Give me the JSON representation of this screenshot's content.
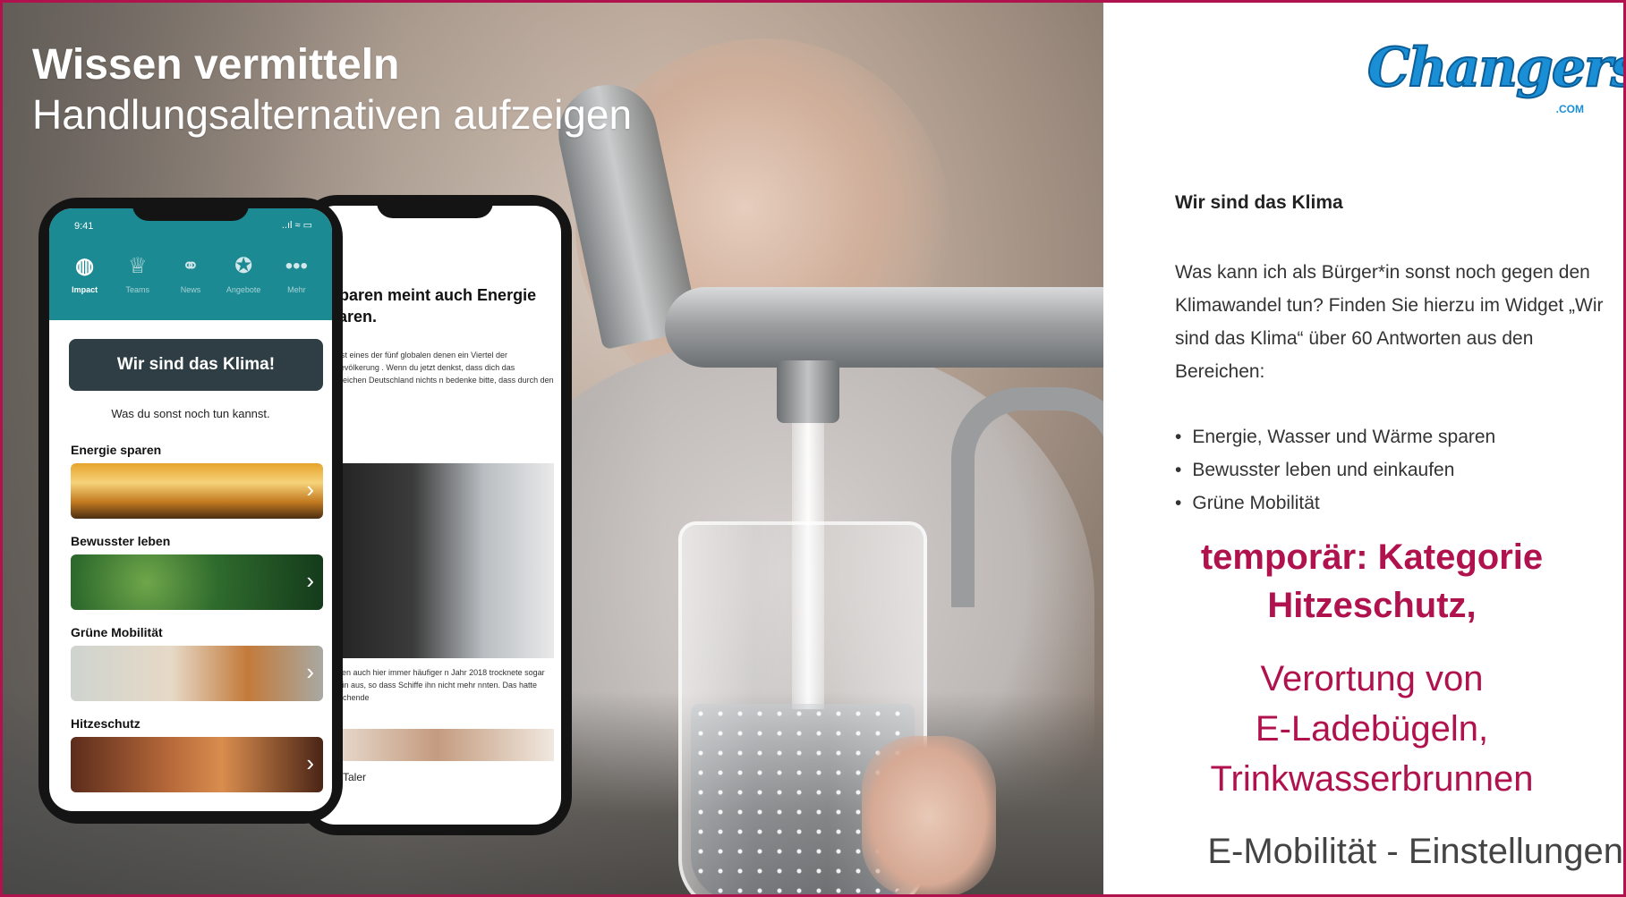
{
  "slide": {
    "heading": "Wissen vermitteln",
    "subheading": "Handlungsalternativen aufzeigen",
    "accent_color": "#b0124e"
  },
  "phone_app": {
    "status_time": "9:41",
    "status_right": "..ıl ≈ ▭",
    "nav": [
      {
        "label": "Impact",
        "icon": "globe-icon",
        "glyph": "◍"
      },
      {
        "label": "Teams",
        "icon": "trophy-icon",
        "glyph": "♕"
      },
      {
        "label": "News",
        "icon": "megaphone-icon",
        "glyph": "⚭"
      },
      {
        "label": "Angebote",
        "icon": "badge-icon",
        "glyph": "✪"
      },
      {
        "label": "Mehr",
        "icon": "more-icon",
        "glyph": "•••"
      }
    ],
    "klima_button": "Wir sind das Klima!",
    "subtitle": "Was du sonst noch tun kannst.",
    "categories": [
      {
        "title": "Energie sparen"
      },
      {
        "title": "Bewusster leben"
      },
      {
        "title": "Grüne Mobilität"
      },
      {
        "title": "Hitzeschutz"
      }
    ],
    "chevron": "›",
    "bar_color": "#1b8a93"
  },
  "phone_article": {
    "headline": "r sparen meint auch Energie sparen.",
    "text_1": "pheit ist eines der fünf globalen denen ein Viertel der Weltbevölkerung . Wenn du jetzt denkst, dass dich das regenreichen Deutschland nichts n bedenke bitte, dass durch den l.",
    "text_2": "perioden auch hier immer häufiger n Jahr 2018 trocknete sogar der hein aus, so dass Schiffe ihn nicht mehr nnten. Das hatte weitreichende",
    "footer": "lima-Taler"
  },
  "panel": {
    "logo_text": "Changers",
    "logo_suffix": ".COM",
    "title": "Wir sind das Klima",
    "paragraph": "Was kann ich als Bürger*in sonst noch gegen den Klimawandel tun? Finden Sie hierzu im Widget „Wir sind das Klima“ über 60 Antworten aus den Bereichen:",
    "bullets": [
      "Energie, Wasser und Wärme sparen",
      "Bewusster leben und einkaufen",
      "Grüne Mobilität"
    ],
    "temp_line1": "temporär: Kategorie",
    "temp_line2": "Hitzeschutz,",
    "verortung_line1": "Verortung von",
    "verortung_line2": "E-Ladebügeln,",
    "verortung_line3": "Trinkwasserbrunnen",
    "emob": "E-Mobilität - Einstellungen"
  }
}
